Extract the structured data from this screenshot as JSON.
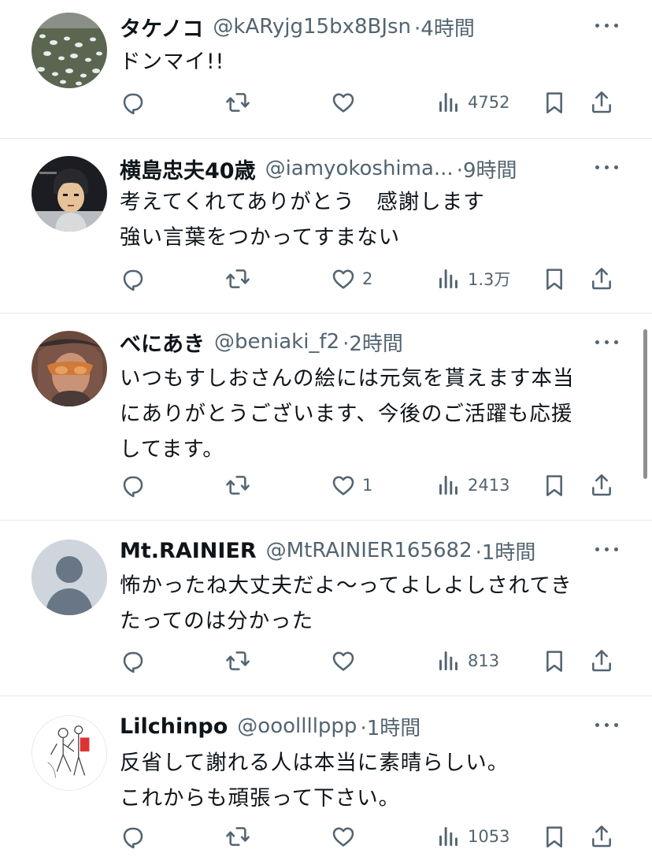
{
  "tweets": [
    {
      "name": "タケノコ",
      "handle": "@kARyjg15bx8BJsn",
      "time": "·4時間",
      "text": "ドンマイ!!",
      "likes": "",
      "views": "4752",
      "avatar": "birds-photo"
    },
    {
      "name": "横島忠夫40歳",
      "handle": "@iamyokoshima...",
      "time": "·9時間",
      "text": "考えてくれてありがとう　感謝します\n強い言葉をつかってすまない",
      "likes": "2",
      "views": "1.3万",
      "avatar": "anime-character"
    },
    {
      "name": "べにあき",
      "handle": "@beniaki_f2",
      "time": "·2時間",
      "text": "いつもすしおさんの絵には元気を貰えます本当\nにありがとうございます、今後のご活躍も応援\nしてます。",
      "likes": "1",
      "views": "2413",
      "avatar": "illustrated-portrait"
    },
    {
      "name": "Mt.RAINIER",
      "handle": "@MtRAINIER165682",
      "time": "·1時間",
      "text": "怖かったね大丈夫だよ〜ってよしよしされてき\nたってのは分かった",
      "likes": "",
      "views": "813",
      "avatar": "default-avatar"
    },
    {
      "name": "Lilchinpo",
      "handle": "@ooollllppp",
      "time": "·1時間",
      "text": "反省して謝れる人は本当に素晴らしい。\nこれからも頑張って下さい。",
      "likes": "",
      "views": "1053",
      "avatar": "sketch-figures"
    }
  ],
  "colors": {
    "text": "#0f1419",
    "secondary": "#536471",
    "divider": "#e6e8eb",
    "background": "#ffffff"
  },
  "icons": [
    "reply-icon",
    "retweet-icon",
    "like-icon",
    "views-icon",
    "bookmark-icon",
    "share-icon",
    "more-icon"
  ]
}
